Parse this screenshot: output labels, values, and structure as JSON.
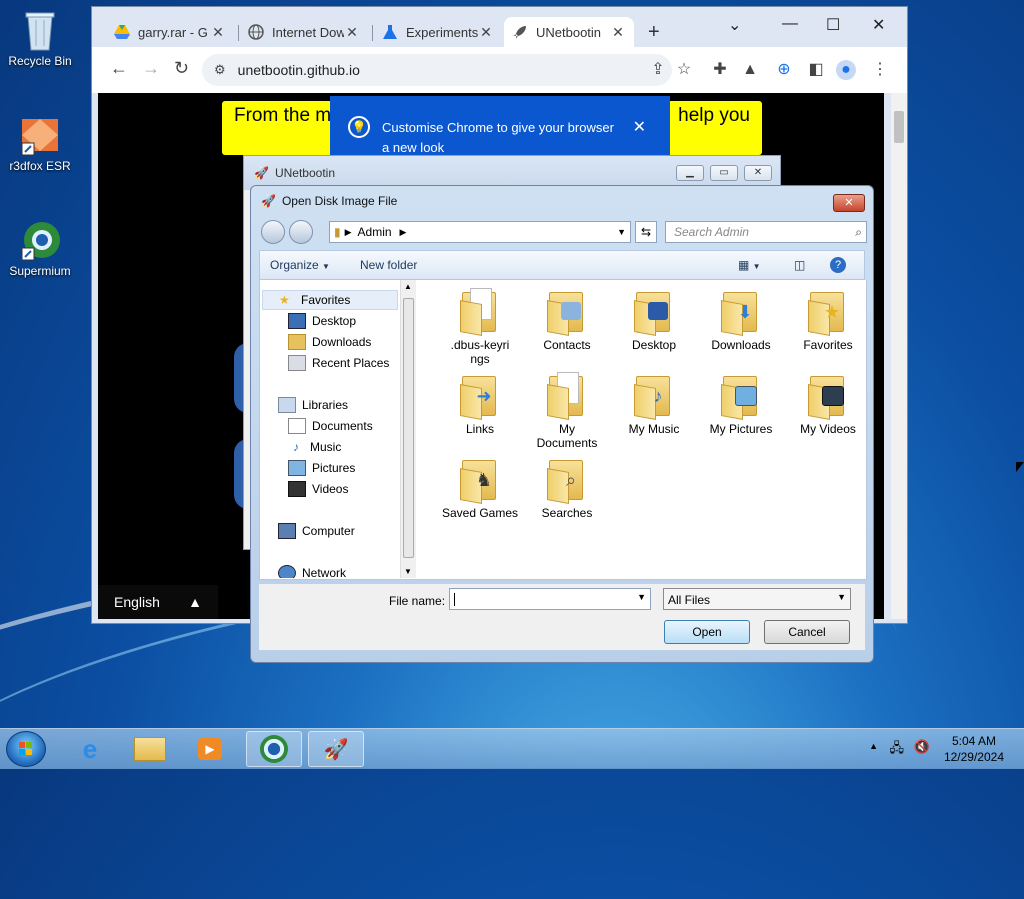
{
  "desktop": {
    "icons": [
      {
        "label": "Recycle Bin"
      },
      {
        "label": "r3dfox ESR"
      },
      {
        "label": "Supermium"
      }
    ]
  },
  "chrome": {
    "tabs": [
      {
        "title": "garry.rar - G",
        "icon": "google-drive-icon"
      },
      {
        "title": "Internet Dow",
        "icon": "globe-icon"
      },
      {
        "title": "Experiments",
        "icon": "flask-icon"
      },
      {
        "title": "UNetbootin",
        "icon": "rocket-icon",
        "active": true
      }
    ],
    "new_tab": "+",
    "url": "unetbootin.github.io",
    "page": {
      "banner_left": "From the m",
      "banner_right": "help you",
      "language": "English"
    },
    "promo": {
      "text": "Customise Chrome to give your browser a new look"
    }
  },
  "unetbootin": {
    "title": "UNetbootin"
  },
  "dialog": {
    "title": "Open Disk Image File",
    "address": "Admin",
    "search_placeholder": "Search Admin",
    "organize": "Organize",
    "new_folder": "New folder",
    "nav": {
      "favorites": "Favorites",
      "favorites_items": [
        "Desktop",
        "Downloads",
        "Recent Places"
      ],
      "libraries": "Libraries",
      "libraries_items": [
        "Documents",
        "Music",
        "Pictures",
        "Videos"
      ],
      "computer": "Computer",
      "network": "Network"
    },
    "files": [
      {
        "name": ".dbus-keyri ngs"
      },
      {
        "name": "Contacts"
      },
      {
        "name": "Desktop"
      },
      {
        "name": "Downloads"
      },
      {
        "name": "Favorites"
      },
      {
        "name": "Links"
      },
      {
        "name": "My Documents"
      },
      {
        "name": "My Music"
      },
      {
        "name": "My Pictures"
      },
      {
        "name": "My Videos"
      },
      {
        "name": "Saved Games"
      },
      {
        "name": "Searches"
      }
    ],
    "file_name_label": "File name:",
    "file_name_value": "",
    "file_type": "All Files",
    "open": "Open",
    "cancel": "Cancel"
  },
  "taskbar": {
    "time": "5:04 AM",
    "date": "12/29/2024"
  }
}
